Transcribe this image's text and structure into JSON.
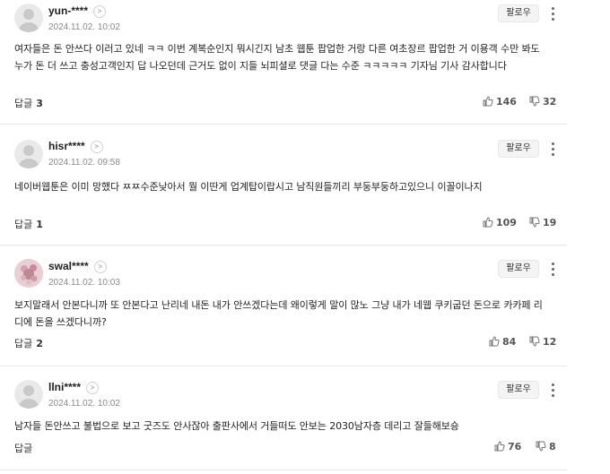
{
  "follow_label": "팔로우",
  "reply_label": "답글",
  "comments": [
    {
      "username": "yun-****",
      "date": "2024.11.02. 10:02",
      "text": "여자들은 돈 안쓰다 이러고 있네 ㅋㅋ 이번 계복순인지 뭐시긴지 남초 웹툰 팝업한 거랑 다른 여초장르 팝업한 거 이용객 수만 봐도 누가 돈 더 쓰고 충성고객인지 답 나오던데 근거도 없이 지들 뇌피셜로 댓글 다는 수준 ㅋㅋㅋㅋㅋ 기자님 기사 감사합니다",
      "reply_count": "3",
      "likes": "146",
      "dislikes": "32"
    },
    {
      "username": "hisr****",
      "date": "2024.11.02. 09:58",
      "text": "네이버웹툰은 이미 망했다 ㅉㅉ수준낮아서 뭘 이딴게 업계탑이랍시고 남직원들끼리 부둥부둥하고있으니 이꼴이나지",
      "reply_count": "1",
      "likes": "109",
      "dislikes": "19"
    },
    {
      "username": "swal****",
      "date": "2024.11.02. 10:03",
      "text": "보지말래서 안본다니까 또 안본다고 난리네 내돈 내가 안쓰겠다는데 왜이렇게 말이 많노 그냥 내가 네웹 쿠키굽던 돈으로 카카페 리디에 돈을 쓰겠다니까?",
      "reply_count": "2",
      "likes": "84",
      "dislikes": "12"
    },
    {
      "username": "llni****",
      "date": "2024.11.02. 10:02",
      "text": "남자들 돈안쓰고 불법으로 보고 굿즈도 안사잖아 출판사에서 거들떠도 안보는 2030남자층 데리고 잘들해보숑",
      "reply_count": "",
      "likes": "76",
      "dislikes": "8"
    }
  ]
}
